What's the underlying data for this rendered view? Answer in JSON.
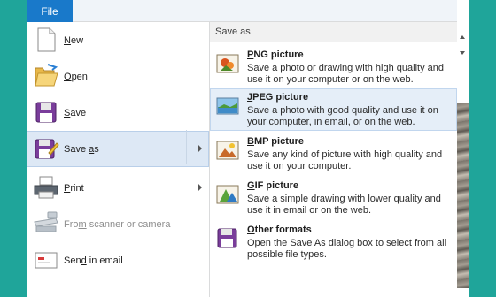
{
  "file_tab": {
    "label": "File"
  },
  "menu": {
    "items": [
      {
        "label": "New",
        "mnemonic": "N",
        "rest": "ew",
        "icon": "new-document-icon"
      },
      {
        "label": "Open",
        "mnemonic": "O",
        "rest": "pen",
        "icon": "open-folder-icon"
      },
      {
        "label": "Save",
        "mnemonic": "S",
        "rest": "ave",
        "icon": "floppy-disk-icon"
      },
      {
        "label": "Save as",
        "pre": "Save ",
        "mnemonic": "a",
        "rest": "s",
        "icon": "save-as-icon",
        "active": true,
        "submenu": true
      },
      {
        "label": "Print",
        "mnemonic": "P",
        "rest": "rint",
        "icon": "printer-icon",
        "submenu": true
      },
      {
        "label": "From scanner or camera",
        "pre": "Fro",
        "mnemonic": "m",
        "rest": " scanner or camera",
        "icon": "scanner-camera-icon",
        "disabled": true
      },
      {
        "label": "Send in email",
        "pre": "Sen",
        "mnemonic": "d",
        "rest": " in email",
        "icon": "email-icon"
      }
    ]
  },
  "save_as_pane": {
    "header": "Save as",
    "options": [
      {
        "title": "PNG picture",
        "mnemonic": "P",
        "rest": "NG picture",
        "desc": "Save a photo or drawing with high quality and use it on your computer or on the web.",
        "icon": "png-picture-icon"
      },
      {
        "title": "JPEG picture",
        "mnemonic": "J",
        "rest": "PEG picture",
        "desc": "Save a photo with good quality and use it on your computer, in email, or on the web.",
        "icon": "jpeg-picture-icon",
        "highlighted": true
      },
      {
        "title": "BMP picture",
        "mnemonic": "B",
        "rest": "MP picture",
        "desc": "Save any kind of picture with high quality and use it on your computer.",
        "icon": "bmp-picture-icon"
      },
      {
        "title": "GIF picture",
        "mnemonic": "G",
        "rest": "IF picture",
        "desc": "Save a simple drawing with lower quality and use it in email or on the web.",
        "icon": "gif-picture-icon"
      },
      {
        "title": "Other formats",
        "mnemonic": "O",
        "rest": "ther formats",
        "desc": "Open the Save As dialog box to select from all possible file types.",
        "icon": "other-formats-icon"
      }
    ]
  },
  "colors": {
    "background": "#1fa59a",
    "file_tab": "#1979ca",
    "highlight": "#dde8f5"
  }
}
